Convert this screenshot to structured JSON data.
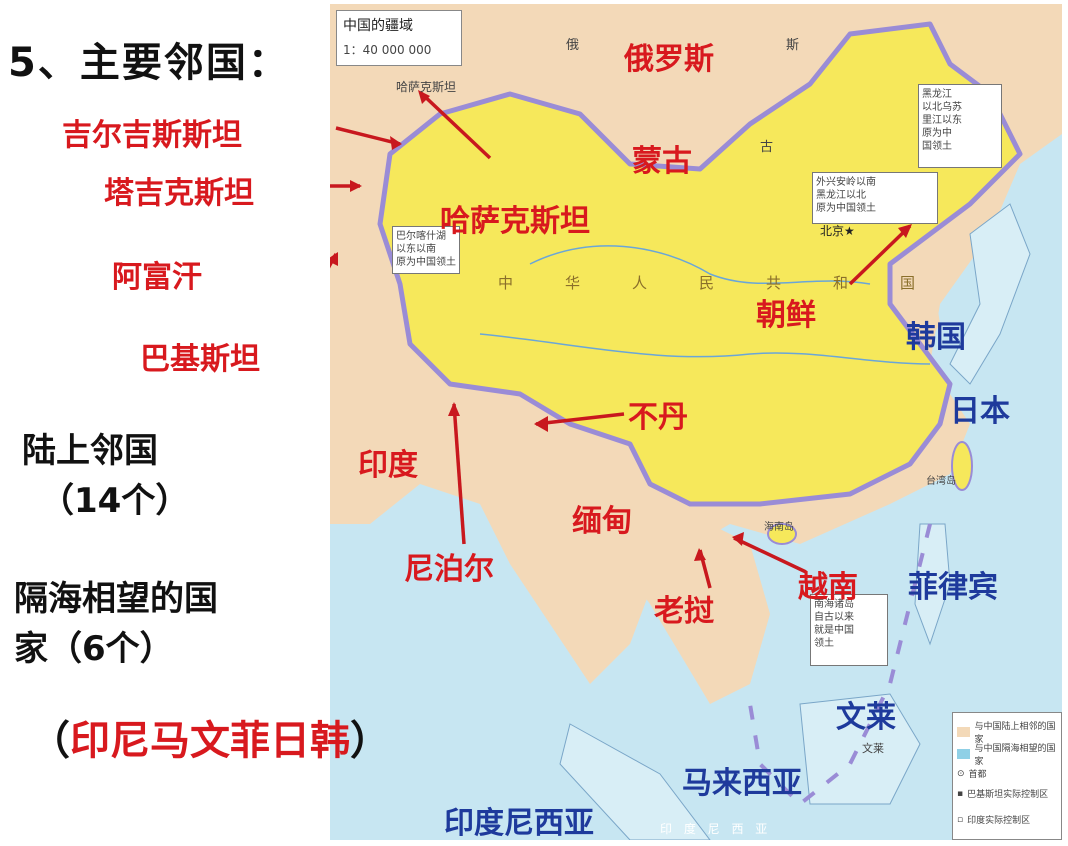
{
  "slide": {
    "heading": "5、主要邻国：",
    "land_neighbors_line1": "陆上邻国",
    "land_neighbors_line2": "（14个）",
    "sea_neighbors_line1": "隔海相望的国",
    "sea_neighbors_line2": "家（6个）",
    "sea_list_open": "（",
    "sea_list": "印尼马文菲日韩",
    "sea_list_close": "）"
  },
  "map": {
    "title": "中国的疆域",
    "scale": "1：40 000 000",
    "china_name": "中华人民共和国",
    "beijing": "北京★",
    "russia_ru": "俄",
    "russia_si": "斯",
    "mongolia_gu": "古",
    "kazakh_small": "哈萨克斯坦",
    "note_northeast": "黑龙江\n以北乌苏\n里江以东\n原为中\n国领土",
    "note_north": "外兴安岭以南\n黑龙江以北\n原为中国领土",
    "note_west": "巴尔喀什湖\n以东以南\n原为中国领土",
    "note_south": "南海诸岛\n自古以来\n就是中国\n领土",
    "hainan": "海南岛",
    "taiwan": "台湾岛",
    "brunei_small": "文莱",
    "indonesia_small": "印 度 尼 西 亚",
    "legend": {
      "item1": "与中国陆上相邻的国家",
      "item2": "与中国隔海相望的国家",
      "item3": "首都",
      "item4": "巴基斯坦实际控制区",
      "item5": "印度实际控制区"
    },
    "colors": {
      "china": "#f6e85b",
      "land": "#f3d9b8",
      "sea": "#c7e6f2",
      "border": "#9a8cd6",
      "arrow": "#c8181e"
    }
  },
  "labels": {
    "kyrgyzstan": "吉尔吉斯斯坦",
    "tajikistan": "塔吉克斯坦",
    "afghanistan": "阿富汗",
    "pakistan": "巴基斯坦",
    "russia": "俄罗斯",
    "mongolia": "蒙古",
    "kazakhstan": "哈萨克斯坦",
    "north_korea": "朝鲜",
    "south_korea": "韩国",
    "japan": "日本",
    "bhutan": "不丹",
    "india": "印度",
    "myanmar": "缅甸",
    "nepal": "尼泊尔",
    "vietnam": "越南",
    "laos": "老挝",
    "philippines": "菲律宾",
    "brunei": "文莱",
    "malaysia": "马来西亚",
    "indonesia": "印度尼西亚"
  }
}
